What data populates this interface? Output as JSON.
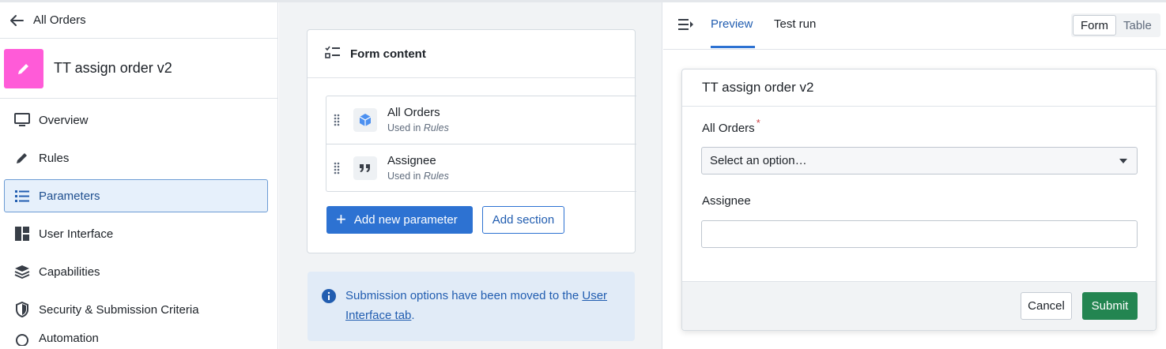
{
  "sidebar": {
    "back_label": "All Orders",
    "title": "TT assign order v2",
    "badge_color": "#ff5bd8",
    "items": [
      {
        "label": "Overview",
        "icon": "monitor-icon"
      },
      {
        "label": "Rules",
        "icon": "pencil-icon"
      },
      {
        "label": "Parameters",
        "icon": "list-icon",
        "active": true
      },
      {
        "label": "User Interface",
        "icon": "layout-icon"
      },
      {
        "label": "Capabilities",
        "icon": "layers-icon"
      },
      {
        "label": "Security & Submission Criteria",
        "icon": "shield-icon"
      },
      {
        "label": "Automation",
        "icon": "automation-icon"
      }
    ]
  },
  "form_content": {
    "title": "Form content",
    "parameters": [
      {
        "name": "All Orders",
        "used_prefix": "Used in",
        "used_in": "Rules",
        "icon": "cube-icon"
      },
      {
        "name": "Assignee",
        "used_prefix": "Used in",
        "used_in": "Rules",
        "icon": "quote-icon"
      }
    ],
    "add_parameter_label": "Add new parameter",
    "add_section_label": "Add section"
  },
  "notice": {
    "text": "Submission options have been moved to the ",
    "link_part1": "User",
    "link_part2": "Interface tab",
    "suffix": "."
  },
  "preview": {
    "tabs": [
      "Preview",
      "Test run"
    ],
    "active_tab": "Preview",
    "view_toggle": [
      "Form",
      "Table"
    ],
    "active_view": "Form",
    "form_title": "TT assign order v2",
    "fields": [
      {
        "label": "All Orders",
        "required_mark": "*",
        "placeholder": "Select an option…"
      },
      {
        "label": "Assignee",
        "value": ""
      }
    ],
    "cancel_label": "Cancel",
    "submit_label": "Submit"
  },
  "colors": {
    "primary": "#2d72d2",
    "submit": "#238551",
    "active_bg": "#e6f0fb"
  }
}
